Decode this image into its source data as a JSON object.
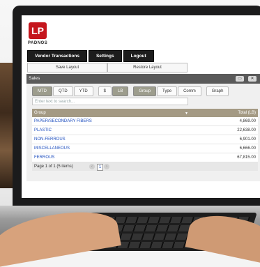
{
  "brand": {
    "logo_text": "LP",
    "name": "PADNOS"
  },
  "nav": [
    "Vendor Transactions",
    "Settings",
    "Logout"
  ],
  "layout": {
    "save": "Save Layout",
    "restore": "Restore Layout"
  },
  "window": {
    "title": "Sales",
    "btn_restore": "▭",
    "btn_close": "✕"
  },
  "tabs": {
    "period": [
      {
        "label": "MTD",
        "active": true
      },
      {
        "label": "QTD"
      },
      {
        "label": "YTD"
      }
    ],
    "units": [
      {
        "label": "$"
      },
      {
        "label": "LB",
        "active": true
      }
    ],
    "view": [
      {
        "label": "Group",
        "active": true
      },
      {
        "label": "Type"
      },
      {
        "label": "Comm"
      }
    ],
    "graph": "Graph"
  },
  "search": {
    "placeholder": "Enter text to search..."
  },
  "grid": {
    "columns": [
      "Group",
      "Total (LB)"
    ],
    "rows": [
      {
        "group": "PAPER/SECONDARY FIBERS",
        "total": "4,869.00"
      },
      {
        "group": "PLASTIC",
        "total": "22,638.00"
      },
      {
        "group": "NON-FERROUS",
        "total": "6,901.00"
      },
      {
        "group": "MISCELLANEOUS",
        "total": "6,666.00"
      },
      {
        "group": "FERROUS",
        "total": "67,815.00"
      }
    ]
  },
  "pager": {
    "text": "Page 1 of 1 (5 items)",
    "current": "1",
    "prev": "‹",
    "next": "›"
  },
  "colors": {
    "brand_red": "#c5161d",
    "grid_header": "#a49a84",
    "link_blue": "#1f4fbf",
    "nav_bg": "#1c1c1c"
  }
}
